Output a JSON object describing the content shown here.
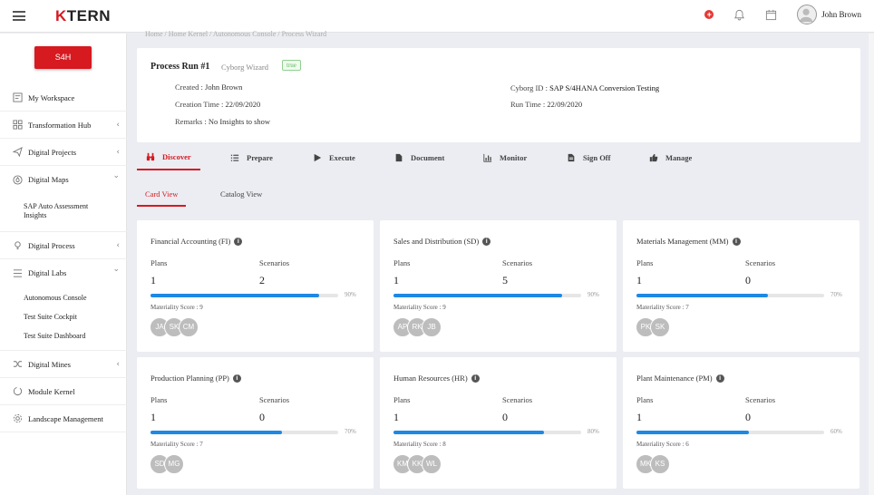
{
  "header": {
    "logo_k": "K",
    "logo_rest": "TERN",
    "plus": "+",
    "user_name": "John Brown"
  },
  "breadcrumb": "Home  /  Home Kernel  /  Autonomous Console  /  Process Wizard",
  "sidebar": {
    "badge": "S4H",
    "items": [
      {
        "label": "My Workspace",
        "icon": "workspace-icon",
        "chev": ""
      },
      {
        "label": "Transformation Hub",
        "icon": "grid-icon",
        "chev": "‹"
      },
      {
        "label": "Digital Projects",
        "icon": "send-icon",
        "chev": "‹"
      },
      {
        "label": "Digital Maps",
        "icon": "map-drop-icon",
        "chev": "⌄"
      },
      {
        "label": "Digital Process",
        "icon": "bulb-icon",
        "chev": "‹"
      },
      {
        "label": "Digital Labs",
        "icon": "list-icon",
        "chev": "⌄"
      },
      {
        "label": "Digital Mines",
        "icon": "shuffle-icon",
        "chev": "‹"
      },
      {
        "label": "Module Kernel",
        "icon": "circle-icon",
        "chev": ""
      },
      {
        "label": "Landscape Management",
        "icon": "gear-icon",
        "chev": ""
      }
    ],
    "maps_sub": [
      "SAP Auto Assessment Insights"
    ],
    "labs_sub": [
      "Autonomous Console",
      "Test Suite Cockpit",
      "Test Suite Dashboard"
    ]
  },
  "run": {
    "title": "Process Run #1",
    "subtitle": "Cyborg Wizard",
    "tag": "true",
    "created_label": "Created :",
    "created_value": "John Brown",
    "creation_time_label": "Creation Time :",
    "creation_time_value": "22/09/2020",
    "remarks_label": "Remarks :",
    "remarks_value": "No Insights to show",
    "cyborg_id_label": "Cyborg ID :",
    "cyborg_id_value": "SAP S/4HANA Conversion Testing",
    "run_time_label": "Run Time :",
    "run_time_value": "22/09/2020"
  },
  "tabs": [
    {
      "label": "Discover",
      "icon": "binoculars-icon"
    },
    {
      "label": "Prepare",
      "icon": "list-icon"
    },
    {
      "label": "Execute",
      "icon": "play-icon"
    },
    {
      "label": "Document",
      "icon": "document-icon"
    },
    {
      "label": "Monitor",
      "icon": "chart-icon"
    },
    {
      "label": "Sign Off",
      "icon": "file-icon"
    },
    {
      "label": "Manage",
      "icon": "thumbs-up-icon"
    }
  ],
  "views": [
    "Card View",
    "Catalog View"
  ],
  "cards": [
    {
      "title": "Financial Accounting (FI)",
      "plans_label": "Plans",
      "plans": "1",
      "scen_label": "Scenarios",
      "scenarios": "2",
      "progress": 0.9,
      "pct": "90%",
      "score_text": "Materiality Score :  9",
      "avatars": [
        "JA",
        "SK",
        "CM"
      ]
    },
    {
      "title": "Sales and Distribution (SD)",
      "plans_label": "Plans",
      "plans": "1",
      "scen_label": "Scenarios",
      "scenarios": "5",
      "progress": 0.9,
      "pct": "90%",
      "score_text": "Materiality Score :  9",
      "avatars": [
        "AP",
        "RK",
        "JB"
      ]
    },
    {
      "title": "Materials Management (MM)",
      "plans_label": "Plans",
      "plans": "1",
      "scen_label": "Scenarios",
      "scenarios": "0",
      "progress": 0.7,
      "pct": "70%",
      "score_text": "Materiality Score :  7",
      "avatars": [
        "PK",
        "SK"
      ]
    },
    {
      "title": "Production Planning (PP)",
      "plans_label": "Plans",
      "plans": "1",
      "scen_label": "Scenarios",
      "scenarios": "0",
      "progress": 0.7,
      "pct": "70%",
      "score_text": "Materiality Score :  7",
      "avatars": [
        "SD",
        "MG"
      ]
    },
    {
      "title": "Human Resources (HR)",
      "plans_label": "Plans",
      "plans": "1",
      "scen_label": "Scenarios",
      "scenarios": "0",
      "progress": 0.8,
      "pct": "80%",
      "score_text": "Materiality Score :  8",
      "avatars": [
        "KM",
        "KK",
        "WL"
      ]
    },
    {
      "title": "Plant Maintenance (PM)",
      "plans_label": "Plans",
      "plans": "1",
      "scen_label": "Scenarios",
      "scenarios": "0",
      "progress": 0.6,
      "pct": "60%",
      "score_text": "Materiality Score :  6",
      "avatars": [
        "MK",
        "KS"
      ]
    }
  ],
  "colors": {
    "brand": "#d71920",
    "progress": "#1e88e5",
    "avatar": "#bdbdbd"
  }
}
